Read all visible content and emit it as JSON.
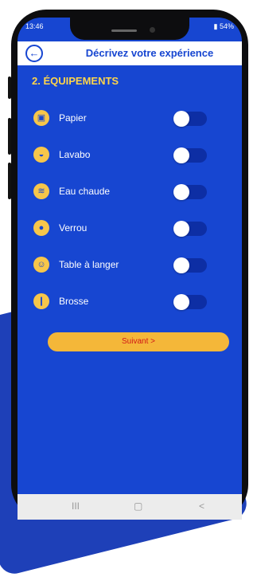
{
  "status": {
    "time": "13:46",
    "battery": "54%"
  },
  "appbar": {
    "title": "Décrivez votre expérience"
  },
  "section": {
    "title": "2. ÉQUIPEMENTS"
  },
  "items": [
    {
      "label": "Papier",
      "icon": "toilet-paper-icon",
      "glyph": "▣",
      "enabled": false
    },
    {
      "label": "Lavabo",
      "icon": "sink-icon",
      "glyph": "◒",
      "enabled": false
    },
    {
      "label": "Eau chaude",
      "icon": "hot-water-icon",
      "glyph": "≋",
      "enabled": false
    },
    {
      "label": "Verrou",
      "icon": "lock-icon",
      "glyph": "●",
      "enabled": false
    },
    {
      "label": "Table à langer",
      "icon": "changing-table-icon",
      "glyph": "☺",
      "enabled": false
    },
    {
      "label": "Brosse",
      "icon": "brush-icon",
      "glyph": "❙",
      "enabled": false
    }
  ],
  "next_button": {
    "label": "Suivant >"
  },
  "navbar": {
    "recent": "III",
    "home": "▢",
    "back": "<"
  },
  "colors": {
    "primary": "#1746d1",
    "accent": "#ffd54a",
    "button": "#f4b739",
    "button_text": "#d01818"
  }
}
